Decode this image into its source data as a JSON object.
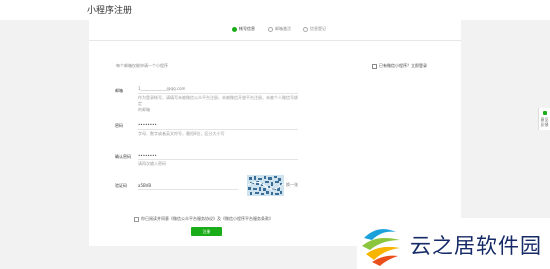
{
  "header": {
    "title": "小程序注册"
  },
  "steps": [
    {
      "label": "帐号信息",
      "active": true
    },
    {
      "label": "邮箱激活",
      "active": false
    },
    {
      "label": "信息登记",
      "active": false
    }
  ],
  "form": {
    "hint": "每个邮箱仅能申请一个小程序",
    "hint_right": "已有微信小程序？立即登录",
    "email": {
      "label": "邮箱",
      "value": "1_____________@qq.com",
      "desc_1": "作为登录帐号，请填写未被微信公众平台注册，未被微信开放平台注册，未被个人微信号绑定",
      "desc_2": "的邮箱"
    },
    "password": {
      "label": "密码",
      "value": "••••••••",
      "desc": "字母、数字或者英文符号，最短8位，区分大小写"
    },
    "confirm_password": {
      "label": "确认密码",
      "value": "••••••••",
      "desc": "请再次输入密码"
    },
    "captcha": {
      "label": "验证码",
      "value": "a5BVB",
      "refresh": "换一张"
    },
    "agree": "你已阅读并同意《微信公众平台服务协议》及《微信小程序平台服务条款》",
    "submit": "注册"
  },
  "side_tab": {
    "label": "意见\n反馈"
  },
  "watermark": {
    "text": "云之居软件园"
  },
  "colors": {
    "accent": "#1aad19",
    "watermark": "#152a66"
  }
}
